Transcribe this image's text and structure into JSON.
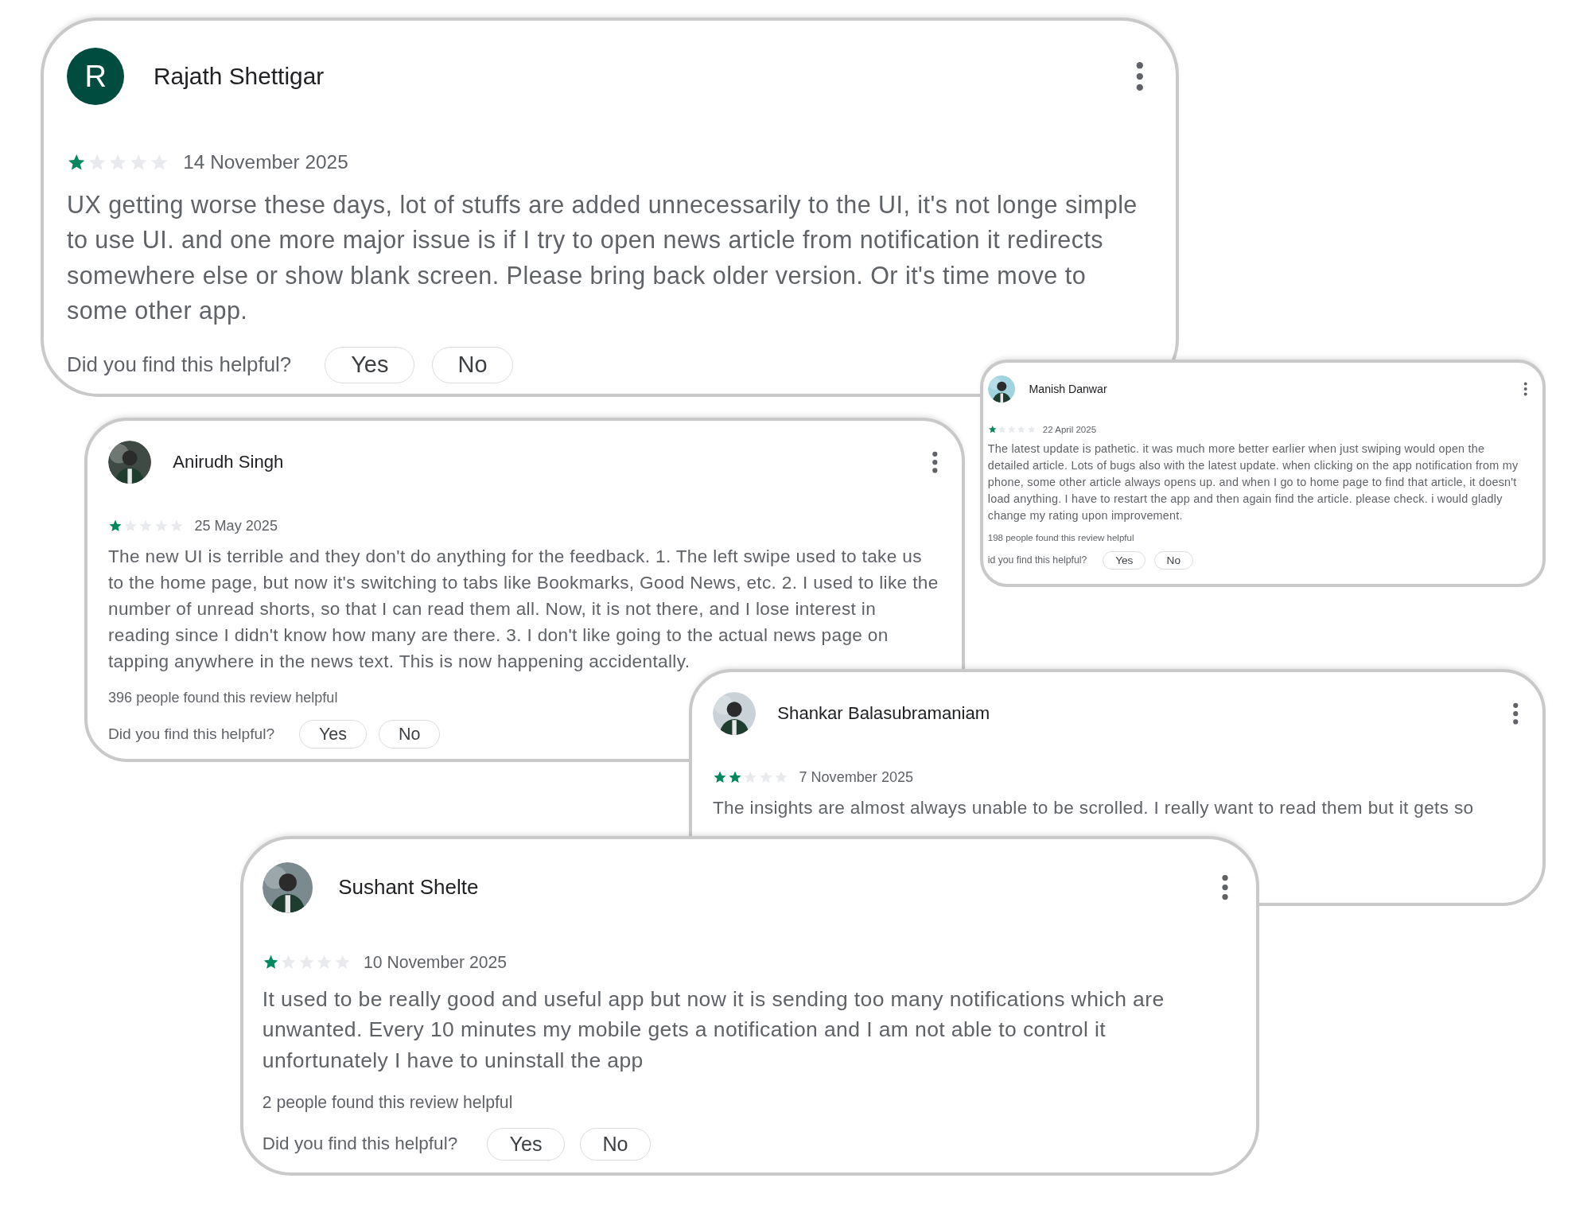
{
  "reviews": [
    {
      "author": "Rajath Shettigar",
      "avatar": {
        "kind": "initial",
        "letter": "R"
      },
      "stars": 1,
      "date": "14 November 2025",
      "text": "UX getting worse these days, lot of stuffs are added unnecessarily to the UI, it's not longe simple to use UI. and one more major issue is if I try to open news article from notification it redirects somewhere else or show blank screen. Please bring back older version. Or it's time move to some other app.",
      "question": "Did you find this helpful?",
      "yes": "Yes",
      "no": "No"
    },
    {
      "author": "Anirudh Singh",
      "stars": 1,
      "date": "25 May 2025",
      "text": "The new UI is terrible and they don't do anything for the feedback. 1. The left swipe used to take us to the home page, but now it's switching to tabs like Bookmarks, Good News, etc. 2. I used to like the number of unread shorts, so that I can read them all. Now, it is not there, and I lose interest in reading since I didn't know how many are there. 3. I don't like going to the actual news page on tapping anywhere in the news text. This is now happening accidentally.",
      "helpful_count": "396 people found this review helpful",
      "question": "Did you find this helpful?",
      "yes": "Yes",
      "no": "No"
    },
    {
      "author": "Manish Danwar",
      "stars": 1,
      "date": "22 April 2025",
      "text": "The latest update is pathetic. it was much more better earlier when just swiping would open the detailed article. Lots of bugs also with the latest update. when clicking on the app notification from my phone, some other article always opens up. and when I go to home page to find that article, it doesn't load anything. I have to restart the app and then again find the article. please check. i would gladly change my rating upon improvement.",
      "helpful_count": "198 people found this review helpful",
      "question": "id you find this helpful?",
      "yes": "Yes",
      "no": "No"
    },
    {
      "author": "Shankar Balasubramaniam",
      "stars": 2,
      "date": "7 November 2025",
      "text": "The insights are almost always unable to be scrolled. I really want to read them but it gets so"
    },
    {
      "author": "Sushant Shelte",
      "stars": 1,
      "date": "10 November 2025",
      "text": "It used to be really good and useful app but now it is sending too many notifications which are unwanted. Every 10 minutes my mobile gets a notification and I am not able to control it unfortunately I have to uninstall the app",
      "helpful_count": "2 people found this review helpful",
      "question": "Did you find this helpful?",
      "yes": "Yes",
      "no": "No"
    }
  ]
}
